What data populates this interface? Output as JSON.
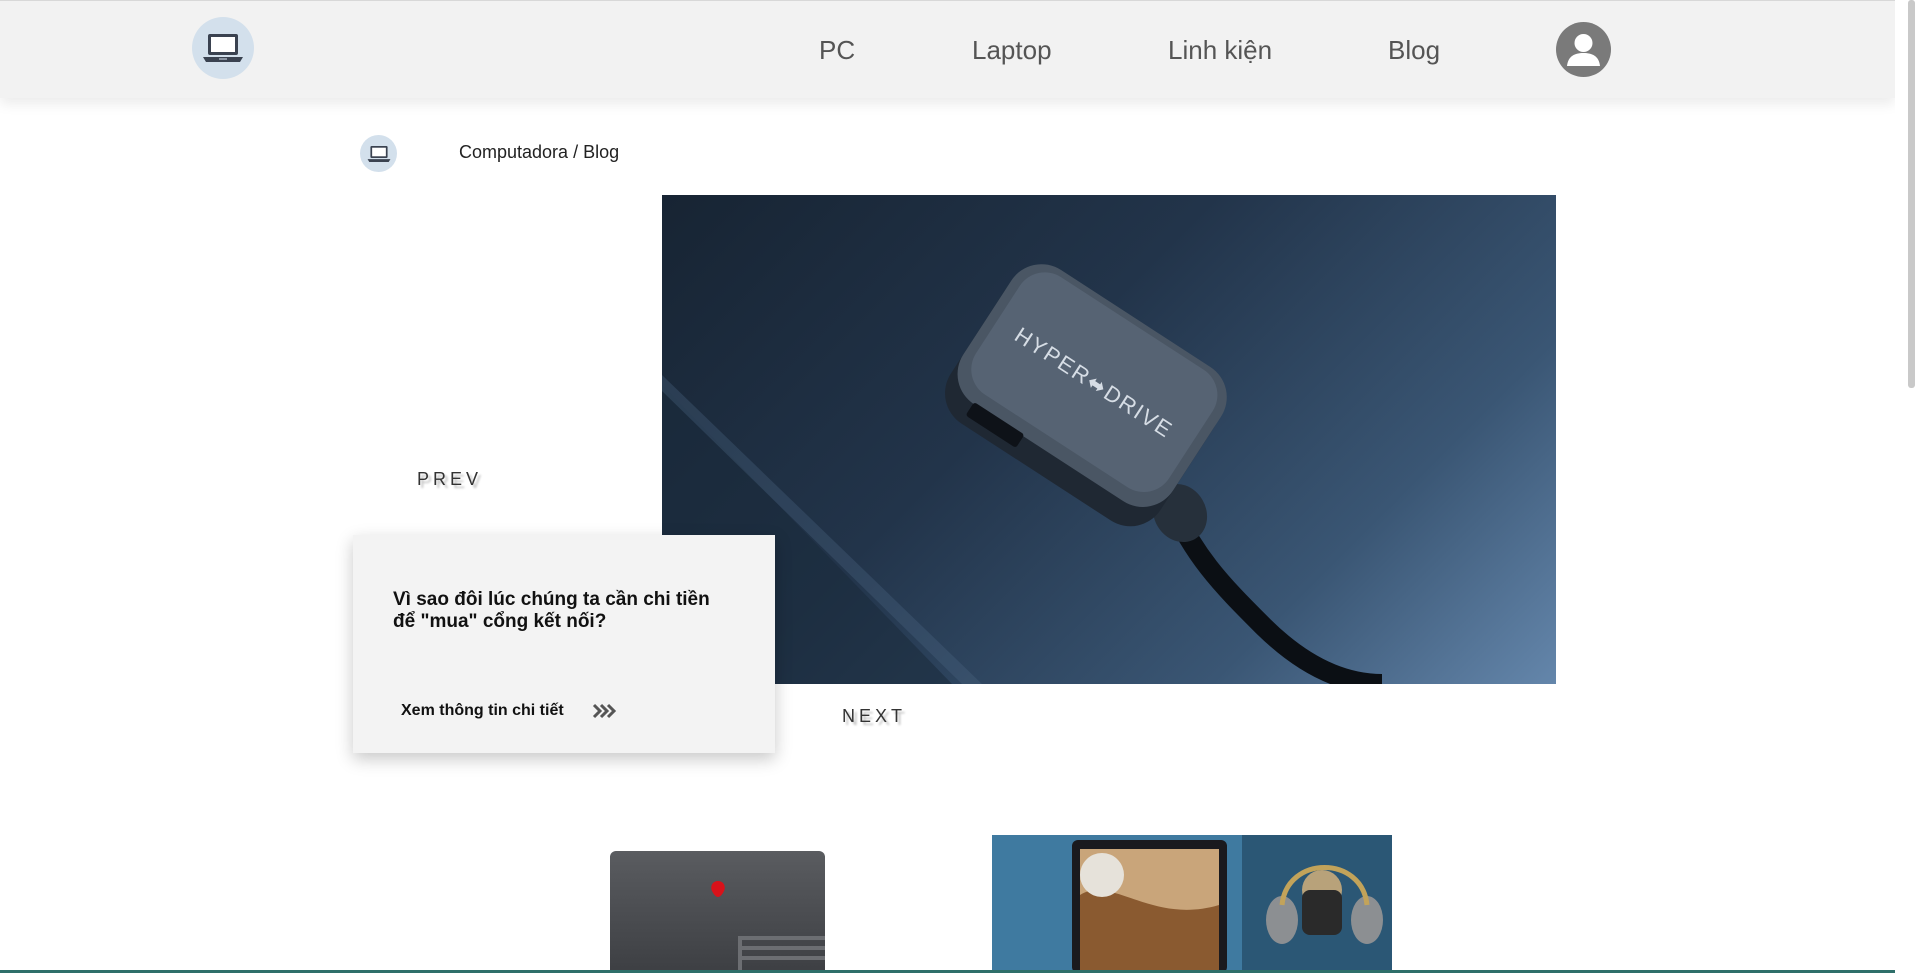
{
  "nav": {
    "items": [
      {
        "label": "PC"
      },
      {
        "label": "Laptop"
      },
      {
        "label": "Linh kiện"
      },
      {
        "label": "Blog"
      }
    ]
  },
  "breadcrumb": {
    "site": "Computadora",
    "separator": " / ",
    "current": "Blog"
  },
  "slider": {
    "prev_label": "PREV",
    "next_label": "NEXT",
    "hero_brand_text": "HYPER⬌DRIVE"
  },
  "card": {
    "title": "Vì sao đôi lúc chúng ta cần chi tiền để \"mua\" cổng kết nối?",
    "link_label": "Xem thông tin chi tiết"
  },
  "colors": {
    "header_bg": "#f2f2f2",
    "logo_bg": "#d3e0ec",
    "avatar_bg": "#7a7a7a",
    "card_bg": "#f3f3f3",
    "footer_accent": "#2e6f6a"
  },
  "icons": {
    "logo": "laptop-icon",
    "avatar": "user-icon",
    "card_link": "triple-chevron-right-icon"
  }
}
